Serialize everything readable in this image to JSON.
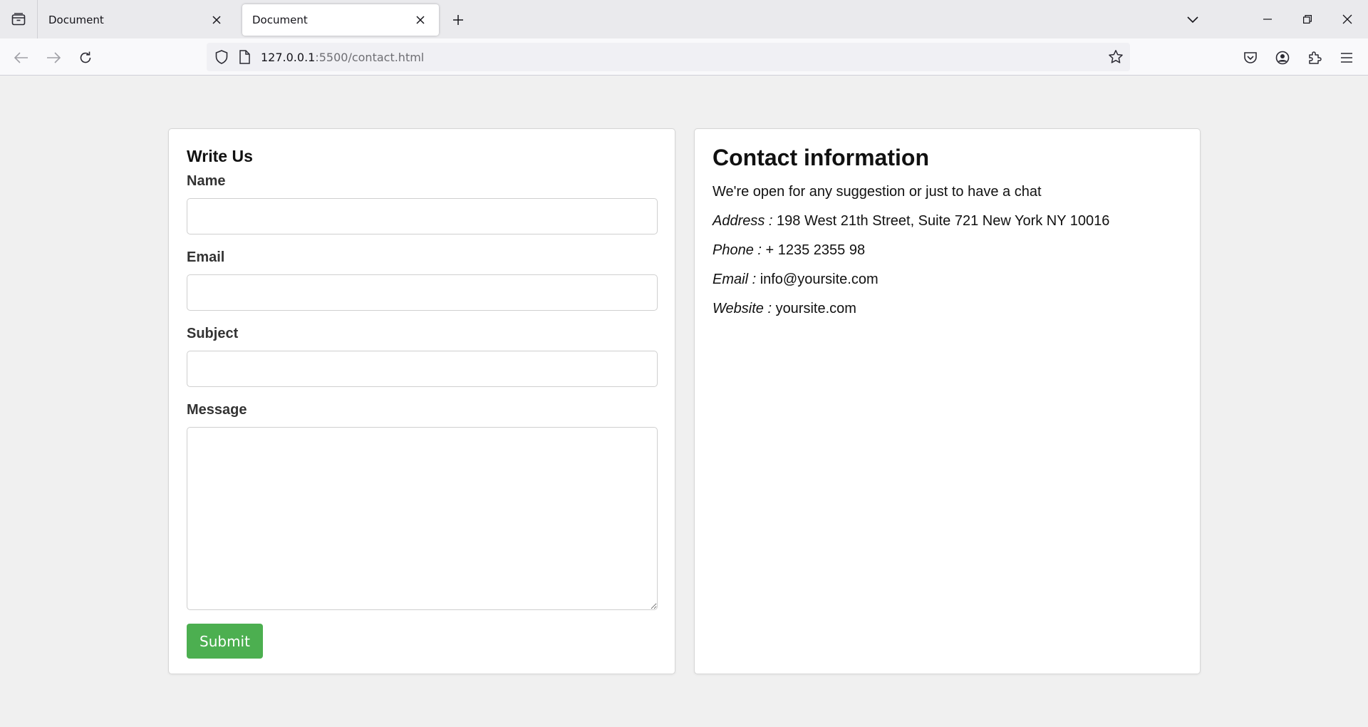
{
  "browser": {
    "tabs": [
      {
        "title": "Document",
        "active": false
      },
      {
        "title": "Document",
        "active": true
      }
    ],
    "url": {
      "host": "127.0.0.1",
      "rest": ":5500/contact.html"
    }
  },
  "form": {
    "title": "Write Us",
    "fields": [
      {
        "label": "Name",
        "value": ""
      },
      {
        "label": "Email",
        "value": ""
      },
      {
        "label": "Subject",
        "value": ""
      },
      {
        "label": "Message",
        "value": ""
      }
    ],
    "submit_label": "Submit",
    "submit_color": "#4caf50"
  },
  "contact": {
    "title": "Contact information",
    "intro": "We're open for any suggestion or just to have a chat",
    "items": [
      {
        "label": "Address :",
        "value": "198 West 21th Street, Suite 721 New York NY 10016"
      },
      {
        "label": "Phone :",
        "value": "+ 1235 2355 98"
      },
      {
        "label": "Email :",
        "value": "info@yoursite.com"
      },
      {
        "label": "Website :",
        "value": "yoursite.com"
      }
    ]
  }
}
